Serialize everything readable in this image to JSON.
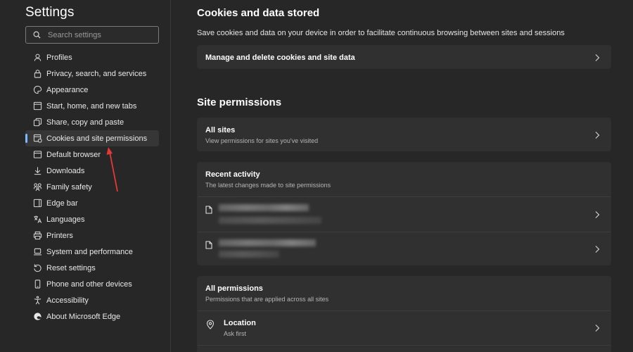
{
  "sidebar": {
    "title": "Settings",
    "search_placeholder": "Search settings",
    "items": [
      {
        "label": "Profiles",
        "icon": "profile-icon",
        "active": false
      },
      {
        "label": "Privacy, search, and services",
        "icon": "lock-icon",
        "active": false
      },
      {
        "label": "Appearance",
        "icon": "appearance-icon",
        "active": false
      },
      {
        "label": "Start, home, and new tabs",
        "icon": "start-home-icon",
        "active": false
      },
      {
        "label": "Share, copy and paste",
        "icon": "share-icon",
        "active": false
      },
      {
        "label": "Cookies and site permissions",
        "icon": "cookies-icon",
        "active": true
      },
      {
        "label": "Default browser",
        "icon": "default-browser-icon",
        "active": false
      },
      {
        "label": "Downloads",
        "icon": "download-icon",
        "active": false
      },
      {
        "label": "Family safety",
        "icon": "family-icon",
        "active": false
      },
      {
        "label": "Edge bar",
        "icon": "edge-bar-icon",
        "active": false
      },
      {
        "label": "Languages",
        "icon": "languages-icon",
        "active": false
      },
      {
        "label": "Printers",
        "icon": "printer-icon",
        "active": false
      },
      {
        "label": "System and performance",
        "icon": "laptop-icon",
        "active": false
      },
      {
        "label": "Reset settings",
        "icon": "reset-icon",
        "active": false
      },
      {
        "label": "Phone and other devices",
        "icon": "phone-icon",
        "active": false
      },
      {
        "label": "Accessibility",
        "icon": "accessibility-icon",
        "active": false
      },
      {
        "label": "About Microsoft Edge",
        "icon": "edge-logo-icon",
        "active": false
      }
    ]
  },
  "main": {
    "cookies_section": {
      "title": "Cookies and data stored",
      "description": "Save cookies and data on your device in order to facilitate continuous browsing between sites and sessions",
      "manage_label": "Manage and delete cookies and site data"
    },
    "site_permissions": {
      "title": "Site permissions",
      "all_sites": {
        "title": "All sites",
        "subtitle": "View permissions for sites you've visited"
      },
      "recent_activity": {
        "title": "Recent activity",
        "subtitle": "The latest changes made to site permissions"
      },
      "all_permissions": {
        "title": "All permissions",
        "subtitle": "Permissions that are applied across all sites"
      },
      "location": {
        "title": "Location",
        "subtitle": "Ask first"
      }
    }
  },
  "colors": {
    "background": "#272727",
    "card": "#303030",
    "accent": "#7cb8ff",
    "annotation_arrow": "#e53935"
  }
}
